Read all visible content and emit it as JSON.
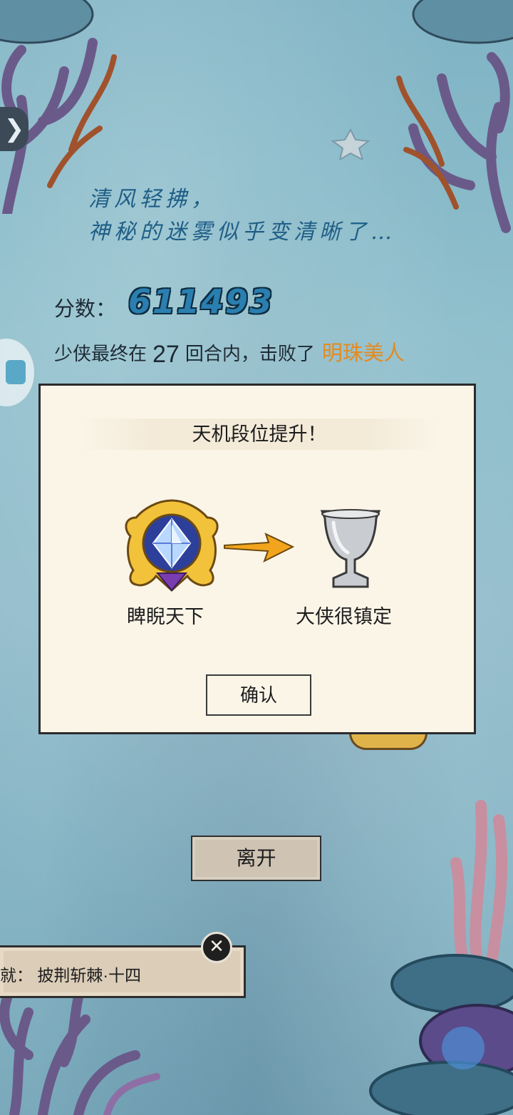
{
  "nav": {
    "side_tab_glyph": "❯"
  },
  "poem": {
    "line1": "清风轻拂，",
    "line2": "神秘的迷雾似乎变清晰了…"
  },
  "score": {
    "label": "分数：",
    "value": "611493"
  },
  "result": {
    "prefix": "少侠最终在",
    "rounds": "27",
    "middle": "回合内，击败了",
    "boss": "明珠美人"
  },
  "dialog": {
    "title": "天机段位提升！",
    "old_rank": "睥睨天下",
    "new_rank": "大侠很镇定",
    "confirm_label": "确认"
  },
  "leave_label": "离开",
  "achievement": {
    "text": "就：  披荆斩棘·十四",
    "close_glyph": "✕"
  },
  "colors": {
    "boss_name": "#e68a1e",
    "score_value": "#2a7fb0",
    "poem_text": "#1f5e86",
    "dialog_bg": "#fbf5e8"
  },
  "icons": {
    "old_rank": "gold-crystal-badge-icon",
    "arrow": "arrow-right-icon",
    "new_rank": "silver-goblet-icon"
  }
}
